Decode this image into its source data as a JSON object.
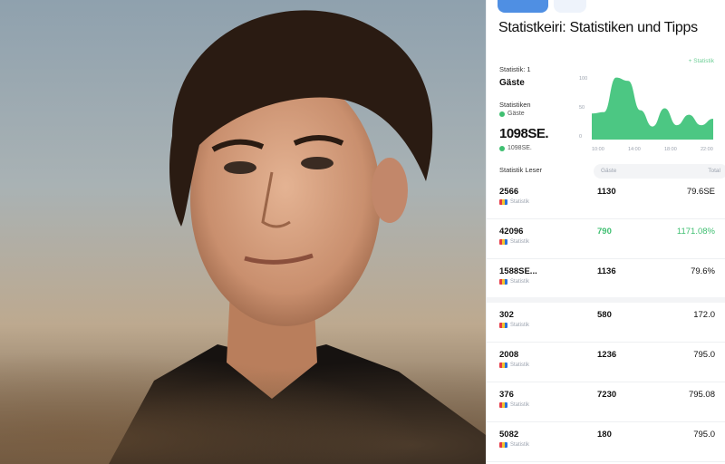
{
  "header": {
    "pills": [
      "",
      ""
    ],
    "title": "Statistkeiri: Statistiken und Tipps"
  },
  "metrics": {
    "label1": "Statistik: 1",
    "value1": "Gäste",
    "label2": "Statistiken",
    "sub2": "Gäste",
    "big": "1098SE.",
    "sub3": "1098SE."
  },
  "chart": {
    "link": "+ Statistik",
    "y_ticks": [
      "100",
      "50",
      "0"
    ],
    "x_ticks": [
      "10:00",
      "14:00",
      "18:00",
      "22:00"
    ]
  },
  "chart_data": {
    "type": "area",
    "x": [
      0,
      1,
      2,
      3,
      4,
      5,
      6,
      7,
      8,
      9,
      10
    ],
    "values": [
      40,
      42,
      95,
      90,
      45,
      20,
      48,
      22,
      38,
      22,
      32
    ],
    "color": "#4cc783"
  },
  "table": {
    "header_label": "Statistik Leser",
    "col1": "Gäste",
    "col2": "Total",
    "rows": [
      {
        "name": "2566",
        "flag_text": "Statistik",
        "mid": "1130",
        "mid_green": false,
        "right": "79.6SE",
        "right_green": false
      },
      {
        "name": "42096",
        "flag_text": "Statistik",
        "mid": "790",
        "mid_green": true,
        "right": "1171.08%",
        "right_green": true
      },
      {
        "name": "1588SE...",
        "flag_text": "Statistik",
        "mid": "1136",
        "mid_green": false,
        "right": "79.6%",
        "right_green": false
      },
      {
        "name": "302",
        "flag_text": "Statistik",
        "mid": "580",
        "mid_green": false,
        "right": "172.0",
        "right_green": false
      },
      {
        "name": "2008",
        "flag_text": "Statistik",
        "mid": "1236",
        "mid_green": false,
        "right": "795.0",
        "right_green": false
      },
      {
        "name": "376",
        "flag_text": "Statistik",
        "mid": "7230",
        "mid_green": false,
        "right": "795.08",
        "right_green": false
      },
      {
        "name": "5082",
        "flag_text": "Statistik",
        "mid": "180",
        "mid_green": false,
        "right": "795.0",
        "right_green": false
      }
    ]
  },
  "colors": {
    "accent": "#4f8fe3",
    "green": "#3fbf71"
  }
}
